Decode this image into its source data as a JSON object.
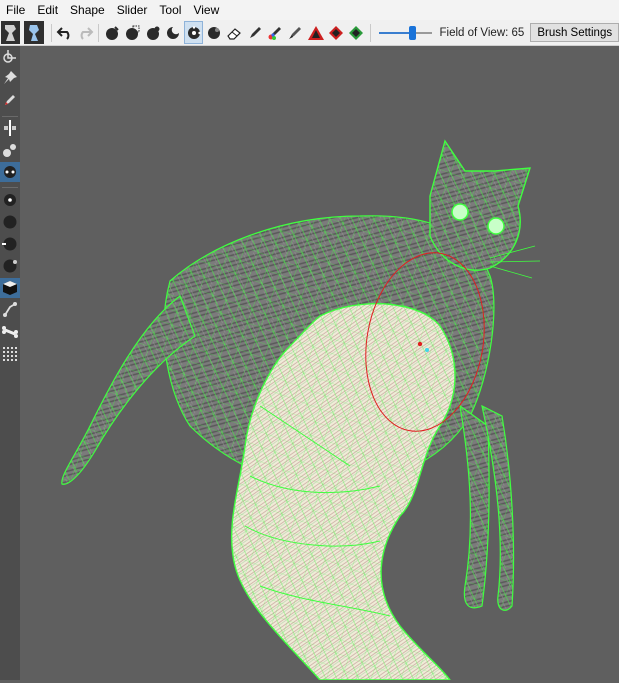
{
  "menu": {
    "items": [
      "File",
      "Edit",
      "Shape",
      "Slider",
      "Tool",
      "View"
    ]
  },
  "toolbar": {
    "field_of_view_label": "Field of View: 65",
    "field_of_view_value": 65,
    "brush_settings_label": "Brush Settings",
    "icons": [
      "app-logo-icon",
      "load-mesh-icon",
      "undo-icon",
      "redo-icon",
      "sphere-brush-icon",
      "mask-sphere-icon",
      "deflate-icon",
      "smooth-icon",
      "move-icon",
      "inflate-icon",
      "eraser-icon",
      "pen-icon",
      "color-brush-icon",
      "paint-brush-icon",
      "weight-warning-icon",
      "diamond-red-icon",
      "diamond-green-icon"
    ]
  },
  "sidebar": {
    "tools": [
      "pivot-icon",
      "pin-icon",
      "pencil-icon",
      "mirror-icon",
      "nodes-icon",
      "connect-icon",
      "dot-icon",
      "circle-filled-icon",
      "circle-arrow-icon",
      "half-circle-icon",
      "cube-icon",
      "vertex-edit-icon",
      "bone-icon",
      "grid-icon"
    ]
  },
  "viewport": {
    "background_color": "#5f5f5f",
    "wire_color": "#3fff3f",
    "brush_ring_color": "#e02020"
  }
}
